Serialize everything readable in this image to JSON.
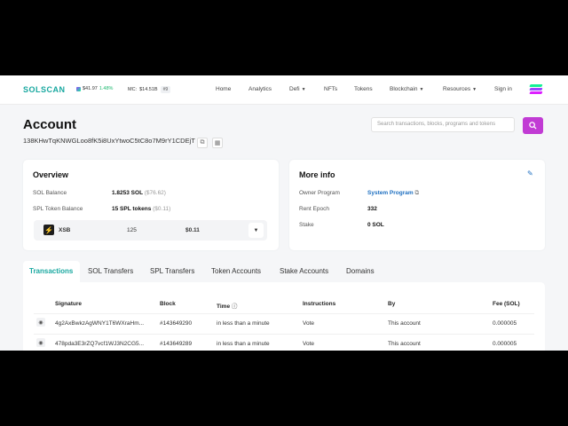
{
  "header": {
    "logo": "SOLSCAN",
    "sol_price": "$41.97",
    "sol_change": "1.48%",
    "mc_label": "MC:",
    "mc_value": "$14.51B",
    "rank": "#9",
    "nav": [
      "Home",
      "Analytics",
      "Defi",
      "NFTs",
      "Tokens",
      "Blockchain",
      "Resources",
      "Sign in"
    ]
  },
  "account": {
    "title": "Account",
    "address": "138KHwTqKNWGLoo8fK5i8UxYtwoC5tC8o7M9rY1CDEjT"
  },
  "search": {
    "placeholder": "Search transactions, blocks, programs and tokens"
  },
  "overview": {
    "title": "Overview",
    "sol_balance_label": "SOL Balance",
    "sol_balance_value": "1.8253 SOL",
    "sol_balance_usd": "($76.62)",
    "spl_label": "SPL Token Balance",
    "spl_value": "15 SPL tokens",
    "spl_usd": "($0.11)",
    "token": {
      "symbol": "XSB",
      "amount": "125",
      "value": "$0.11"
    }
  },
  "more_info": {
    "title": "More info",
    "owner_label": "Owner Program",
    "owner_value": "System Program",
    "rent_label": "Rent Epoch",
    "rent_value": "332",
    "stake_label": "Stake",
    "stake_value": "0 SOL"
  },
  "tabs": [
    "Transactions",
    "SOL Transfers",
    "SPL Transfers",
    "Token Accounts",
    "Stake Accounts",
    "Domains"
  ],
  "table": {
    "headers": [
      "Signature",
      "Block",
      "Time",
      "Instructions",
      "By",
      "Fee (SOL)"
    ],
    "rows": [
      [
        "4g2AxBwkzAgWNY1T6WXraHm...",
        "#143649290",
        "in less than a minute",
        "Vote",
        "This account",
        "0.000005"
      ],
      [
        "478pda3E3rZQ7vcf1WJ3N2CG5...",
        "#143649289",
        "in less than a minute",
        "Vote",
        "This account",
        "0.000005"
      ]
    ]
  },
  "colors": {
    "brand": "#19a8a0",
    "accent": "#c13bd4",
    "link": "#1c6ec0"
  }
}
